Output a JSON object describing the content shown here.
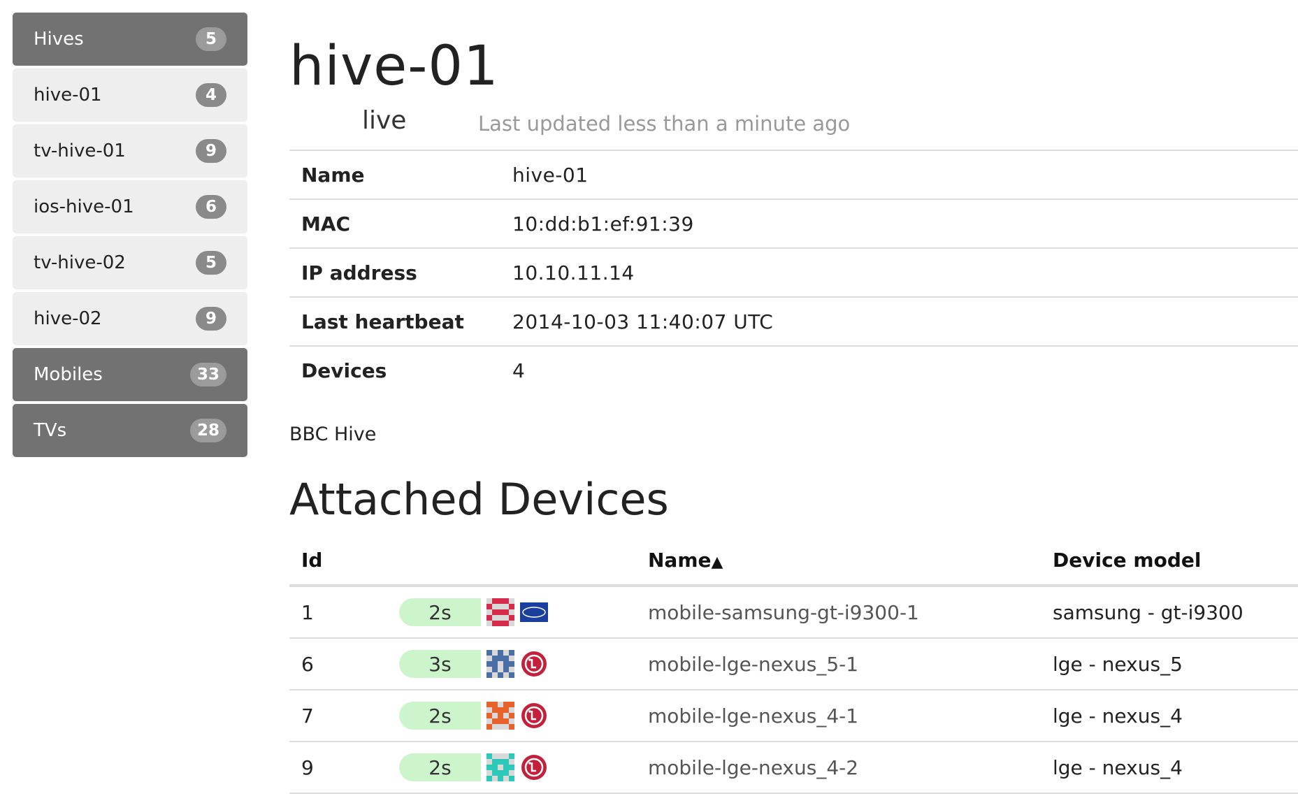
{
  "sidebar": {
    "items": [
      {
        "label": "Hives",
        "count": "5"
      },
      {
        "label": "hive-01",
        "count": "4"
      },
      {
        "label": "tv-hive-01",
        "count": "9"
      },
      {
        "label": "ios-hive-01",
        "count": "6"
      },
      {
        "label": "tv-hive-02",
        "count": "5"
      },
      {
        "label": "hive-02",
        "count": "9"
      },
      {
        "label": "Mobiles",
        "count": "33"
      },
      {
        "label": "TVs",
        "count": "28"
      }
    ]
  },
  "hive": {
    "title": "hive-01",
    "status": "live",
    "last_updated": "Last updated less than a minute ago",
    "details": [
      {
        "key": "Name",
        "value": "hive-01"
      },
      {
        "key": "MAC",
        "value": "10:dd:b1:ef:91:39"
      },
      {
        "key": "IP address",
        "value": "10.10.11.14"
      },
      {
        "key": "Last heartbeat",
        "value": "2014-10-03 11:40:07 UTC"
      },
      {
        "key": "Devices",
        "value": "4"
      }
    ],
    "organisation": "BBC Hive"
  },
  "devices": {
    "heading": "Attached Devices",
    "columns": {
      "id": "Id",
      "name": "Name",
      "sort_indicator": "▲",
      "model": "Device model"
    },
    "rows": [
      {
        "id": "1",
        "age": "2s",
        "brand": "samsung",
        "identicon_color": "#d42c4a",
        "name": "mobile-samsung-gt-i9300-1",
        "model": "samsung - gt-i9300"
      },
      {
        "id": "6",
        "age": "3s",
        "brand": "lg",
        "identicon_color": "#4a6fa5",
        "name": "mobile-lge-nexus_5-1",
        "model": "lge - nexus_5"
      },
      {
        "id": "7",
        "age": "2s",
        "brand": "lg",
        "identicon_color": "#e8632c",
        "name": "mobile-lge-nexus_4-1",
        "model": "lge - nexus_4"
      },
      {
        "id": "9",
        "age": "2s",
        "brand": "lg",
        "identicon_color": "#2cc8b8",
        "name": "mobile-lge-nexus_4-2",
        "model": "lge - nexus_4"
      }
    ]
  },
  "colors": {
    "sidebar_dark": "#727272",
    "sidebar_light": "#eeeeee",
    "age_fresh": "#ccf5cc",
    "lg_brand": "#c5203a",
    "samsung_brand": "#1a3f9e"
  },
  "icons": {
    "identicon": "device-identicon",
    "samsung": "samsung-logo-icon",
    "lg": "lg-logo-icon"
  }
}
